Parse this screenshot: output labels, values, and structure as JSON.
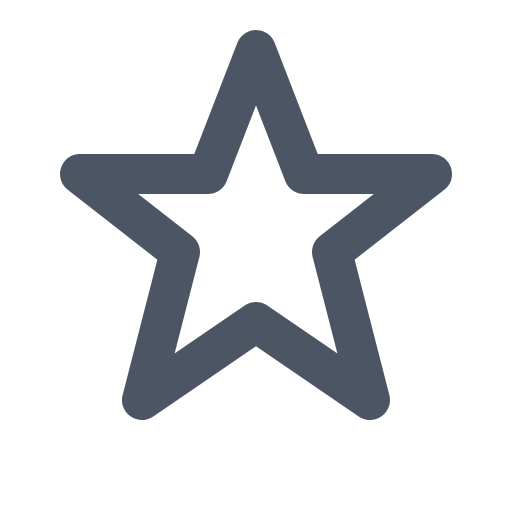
{
  "icon": {
    "name": "star-outline-icon",
    "stroke_color": "#4b5563",
    "background_color": "#ffffff"
  }
}
